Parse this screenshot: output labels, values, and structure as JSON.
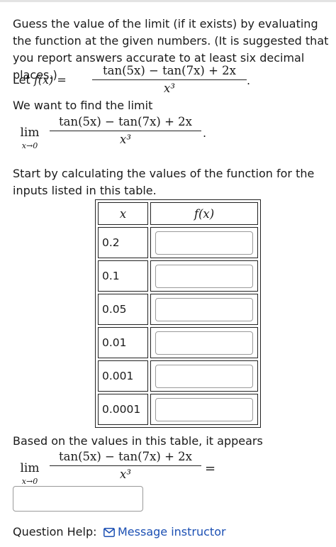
{
  "intro_text": "Guess the value of the limit (if it exists) by evaluating the function at the given numbers. (It is suggested that you report answers accurate to at least six decimal places.)",
  "let_label": "Let",
  "fx_label": "f(x) =",
  "numerator": "tan(5x) − tan(7x) + 2x",
  "denominator": "x³",
  "period": ".",
  "limit_intro": "We want to find the limit",
  "lim_word": "lim",
  "lim_sub": "x→0",
  "table_intro": "Start by calculating the values of the function for the inputs listed in this table.",
  "table": {
    "header_x": "x",
    "header_fx": "f(x)",
    "rows": [
      {
        "x": "0.2",
        "value": ""
      },
      {
        "x": "0.1",
        "value": ""
      },
      {
        "x": "0.05",
        "value": ""
      },
      {
        "x": "0.01",
        "value": ""
      },
      {
        "x": "0.001",
        "value": ""
      },
      {
        "x": "0.0001",
        "value": ""
      }
    ]
  },
  "conclusion_text": "Based on the values in this table, it appears",
  "equals": "=",
  "final_answer_value": "",
  "help_label": "Question Help:",
  "message_link": "Message instructor",
  "colors": {
    "link": "#1b4fb3",
    "input_border": "#9a9a9a"
  }
}
